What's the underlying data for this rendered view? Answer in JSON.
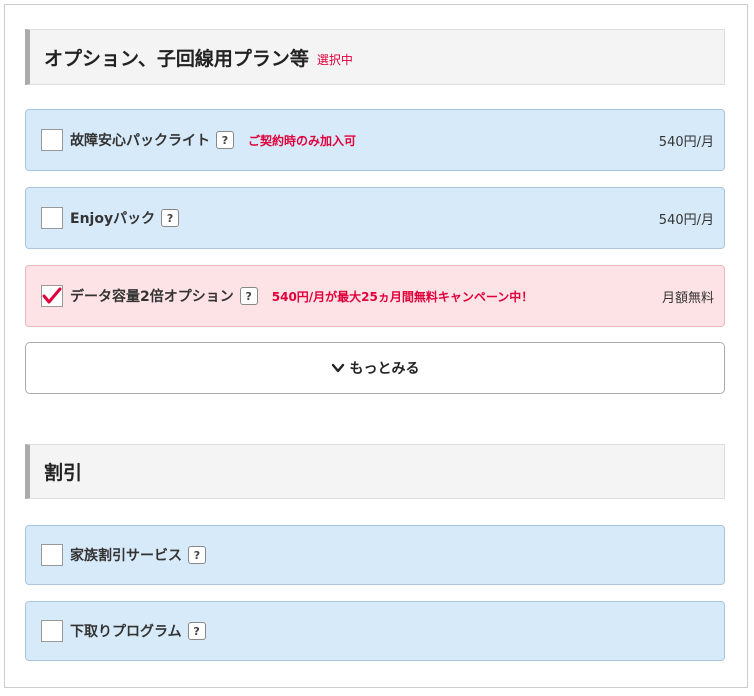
{
  "options_section": {
    "title": "オプション、子回線用プラン等",
    "badge": "選択中"
  },
  "options": [
    {
      "name": "故障安心パックライト",
      "help": "?",
      "note": "ご契約時のみ加入可",
      "price": "540円/月",
      "checked": false
    },
    {
      "name": "Enjoyパック",
      "help": "?",
      "note": "",
      "price": "540円/月",
      "checked": false
    },
    {
      "name": "データ容量2倍オプション",
      "help": "?",
      "note": "540円/月が最大25ヵ月間無料キャンペーン中！",
      "price": "月額無料",
      "checked": true
    }
  ],
  "more_button": {
    "label": "もっとみる",
    "icon": "chevron-down-icon"
  },
  "discount_section": {
    "title": "割引"
  },
  "discounts": [
    {
      "name": "家族割引サービス",
      "help": "?",
      "checked": false
    },
    {
      "name": "下取りプログラム",
      "help": "?",
      "checked": false
    }
  ],
  "colors": {
    "accent_red": "#e0003c",
    "option_blue_bg": "#d7eaf9",
    "option_checked_bg": "#fde3e6",
    "header_bg": "#f4f4f4"
  }
}
